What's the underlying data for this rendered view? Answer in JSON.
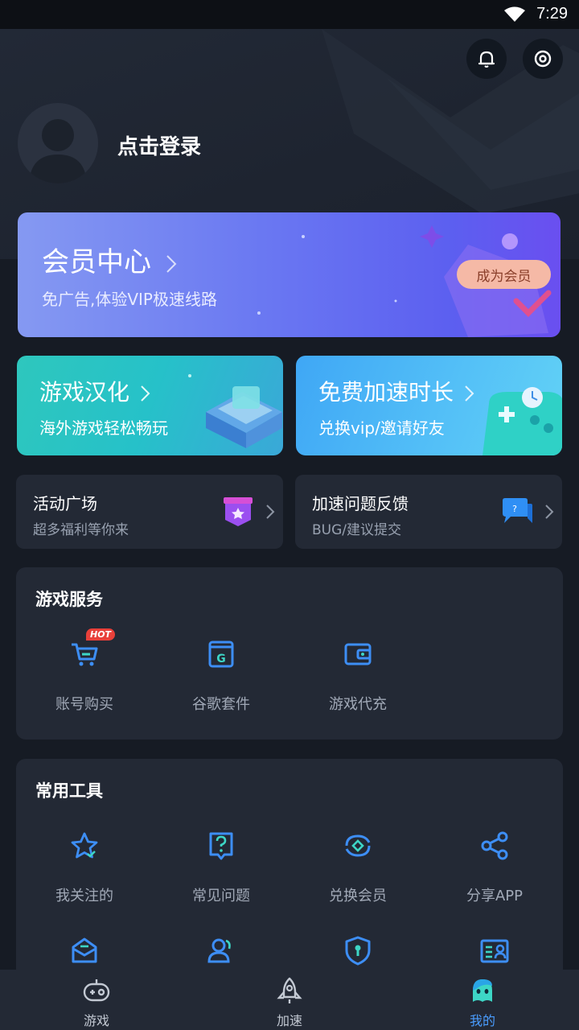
{
  "status": {
    "time": "7:29"
  },
  "header": {
    "login_text": "点击登录"
  },
  "vip": {
    "title": "会员中心",
    "subtitle": "免广告,体验VIP极速线路",
    "button": "成为会员"
  },
  "promos": [
    {
      "title": "游戏汉化",
      "subtitle": "海外游戏轻松畅玩"
    },
    {
      "title": "免费加速时长",
      "subtitle": "兑换vip/邀请好友"
    }
  ],
  "quick_cards": [
    {
      "title": "活动广场",
      "subtitle": "超多福利等你来"
    },
    {
      "title": "加速问题反馈",
      "subtitle": "BUG/建议提交"
    }
  ],
  "game_services": {
    "title": "游戏服务",
    "items": [
      {
        "label": "账号购买",
        "badge": "HOT",
        "icon": "shopping-cart-icon"
      },
      {
        "label": "谷歌套件",
        "icon": "google-kit-icon"
      },
      {
        "label": "游戏代充",
        "icon": "wallet-icon"
      }
    ]
  },
  "tools": {
    "title": "常用工具",
    "items": [
      {
        "label": "我关注的",
        "icon": "star-icon"
      },
      {
        "label": "常见问题",
        "icon": "question-icon"
      },
      {
        "label": "兑换会员",
        "icon": "exchange-icon"
      },
      {
        "label": "分享APP",
        "icon": "share-icon"
      },
      {
        "label": "",
        "icon": "inbox-icon"
      },
      {
        "label": "",
        "icon": "users-icon"
      },
      {
        "label": "",
        "icon": "shield-icon"
      },
      {
        "label": "",
        "icon": "id-card-icon"
      }
    ]
  },
  "tabbar": {
    "items": [
      {
        "label": "游戏",
        "icon": "gamepad-icon"
      },
      {
        "label": "加速",
        "icon": "rocket-icon"
      },
      {
        "label": "我的",
        "icon": "profile-icon",
        "active": true
      }
    ]
  },
  "colors": {
    "accent": "#4a9dff",
    "background": "#161b24",
    "card": "#232935"
  }
}
